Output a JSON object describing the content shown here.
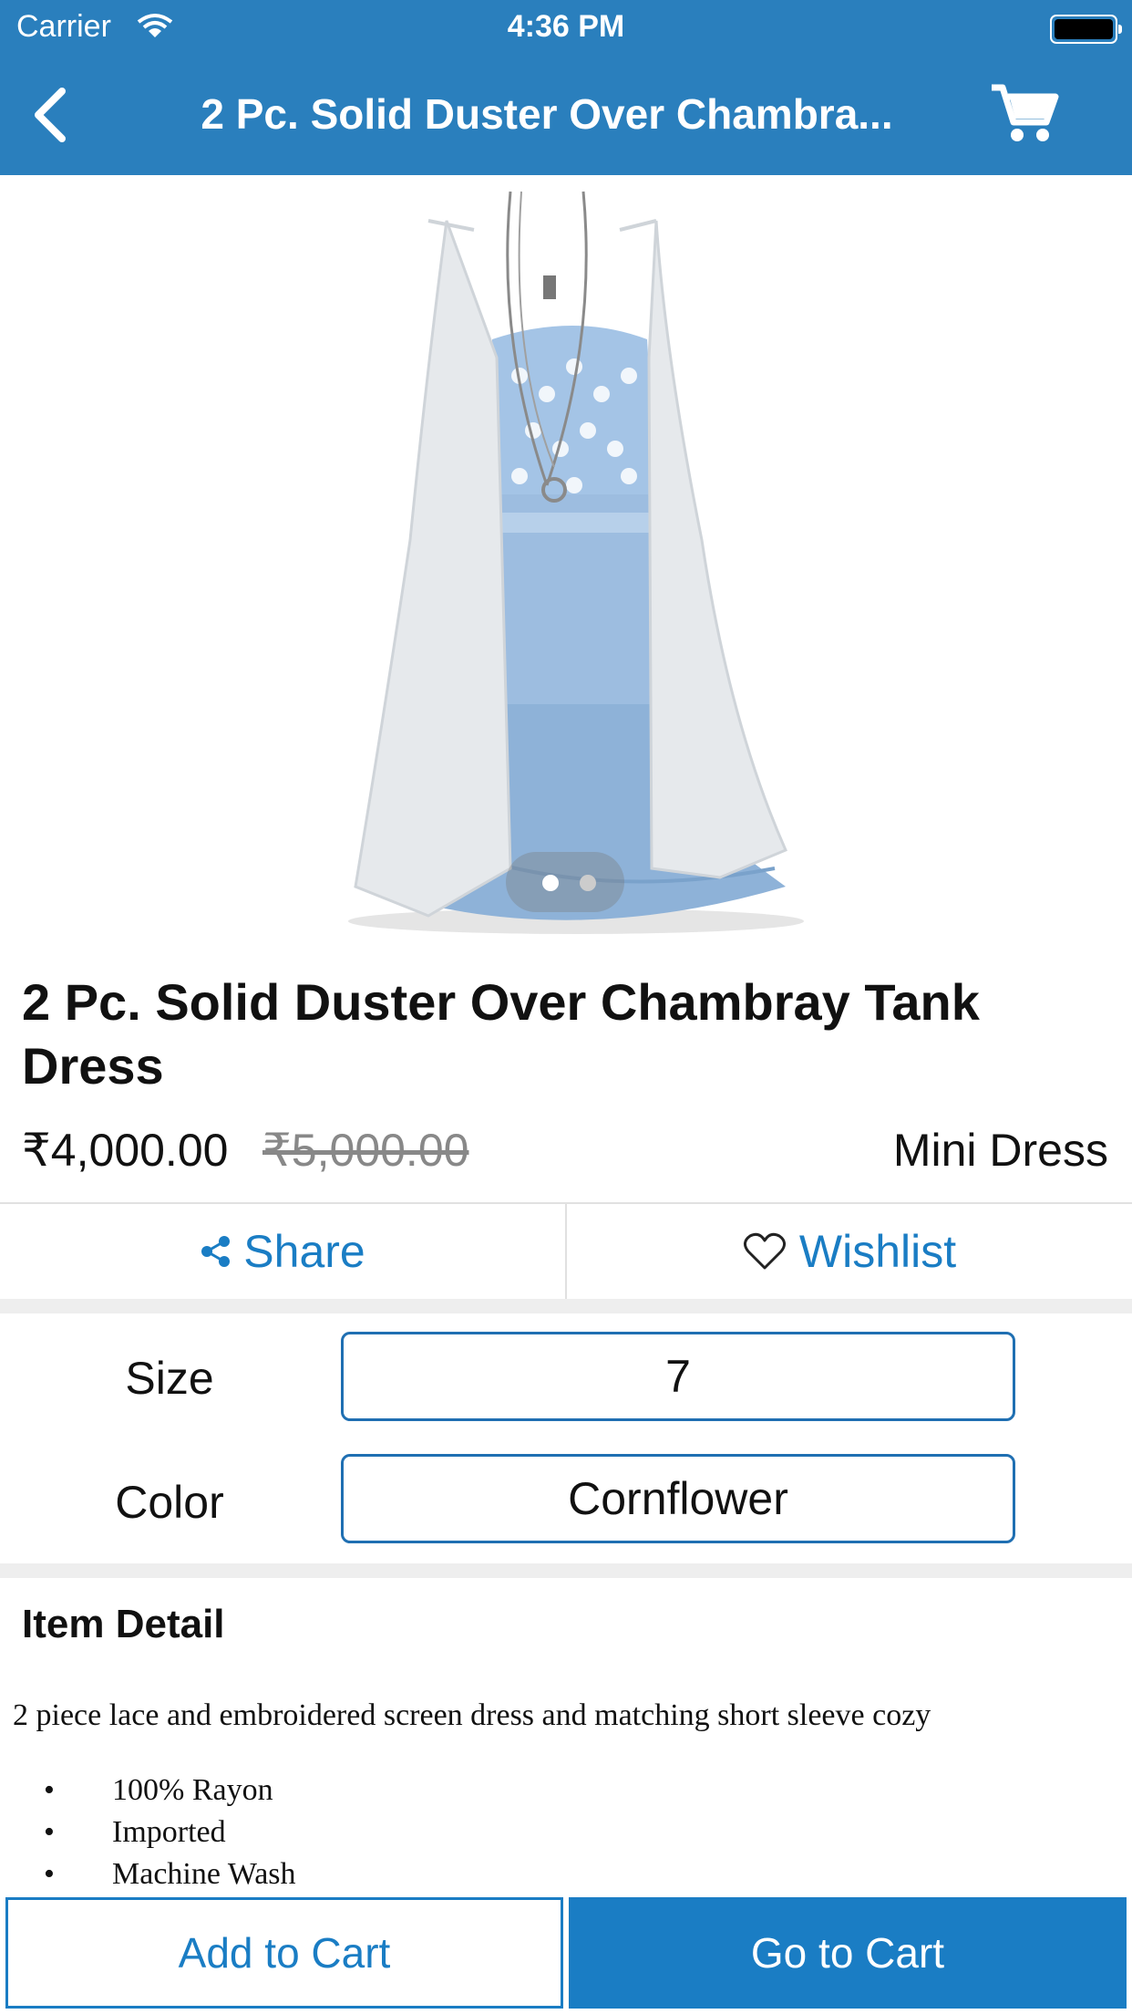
{
  "status_bar": {
    "carrier": "Carrier",
    "time": "4:36 PM"
  },
  "nav": {
    "title": "2 Pc. Solid Duster Over Chambra...",
    "back_icon": "chevron-left-icon",
    "cart_icon": "shopping-cart-icon"
  },
  "gallery": {
    "page_count": 2,
    "current_page": 1
  },
  "product": {
    "title": "2 Pc. Solid Duster Over Chambray Tank Dress",
    "price": "₹4,000.00",
    "original_price": "₹5,000.00",
    "type": "Mini Dress"
  },
  "actions": {
    "share_label": "Share",
    "share_icon": "share-icon",
    "wishlist_label": "Wishlist",
    "wishlist_icon": "heart-outline-icon"
  },
  "options": {
    "size_label": "Size",
    "size_value": "7",
    "color_label": "Color",
    "color_value": "Cornflower"
  },
  "details": {
    "heading": "Item Detail",
    "description": "2 piece lace and embroidered screen dress and matching short sleeve cozy",
    "bullet_marker": "•",
    "bullets": [
      "100% Rayon",
      "Imported",
      "Machine Wash"
    ]
  },
  "footer": {
    "add_to_cart_label": "Add to Cart",
    "go_to_cart_label": "Go to Cart"
  },
  "colors": {
    "brand": "#2a7fbd",
    "accent": "#1a7dc4",
    "divider": "#e1e1e1"
  }
}
